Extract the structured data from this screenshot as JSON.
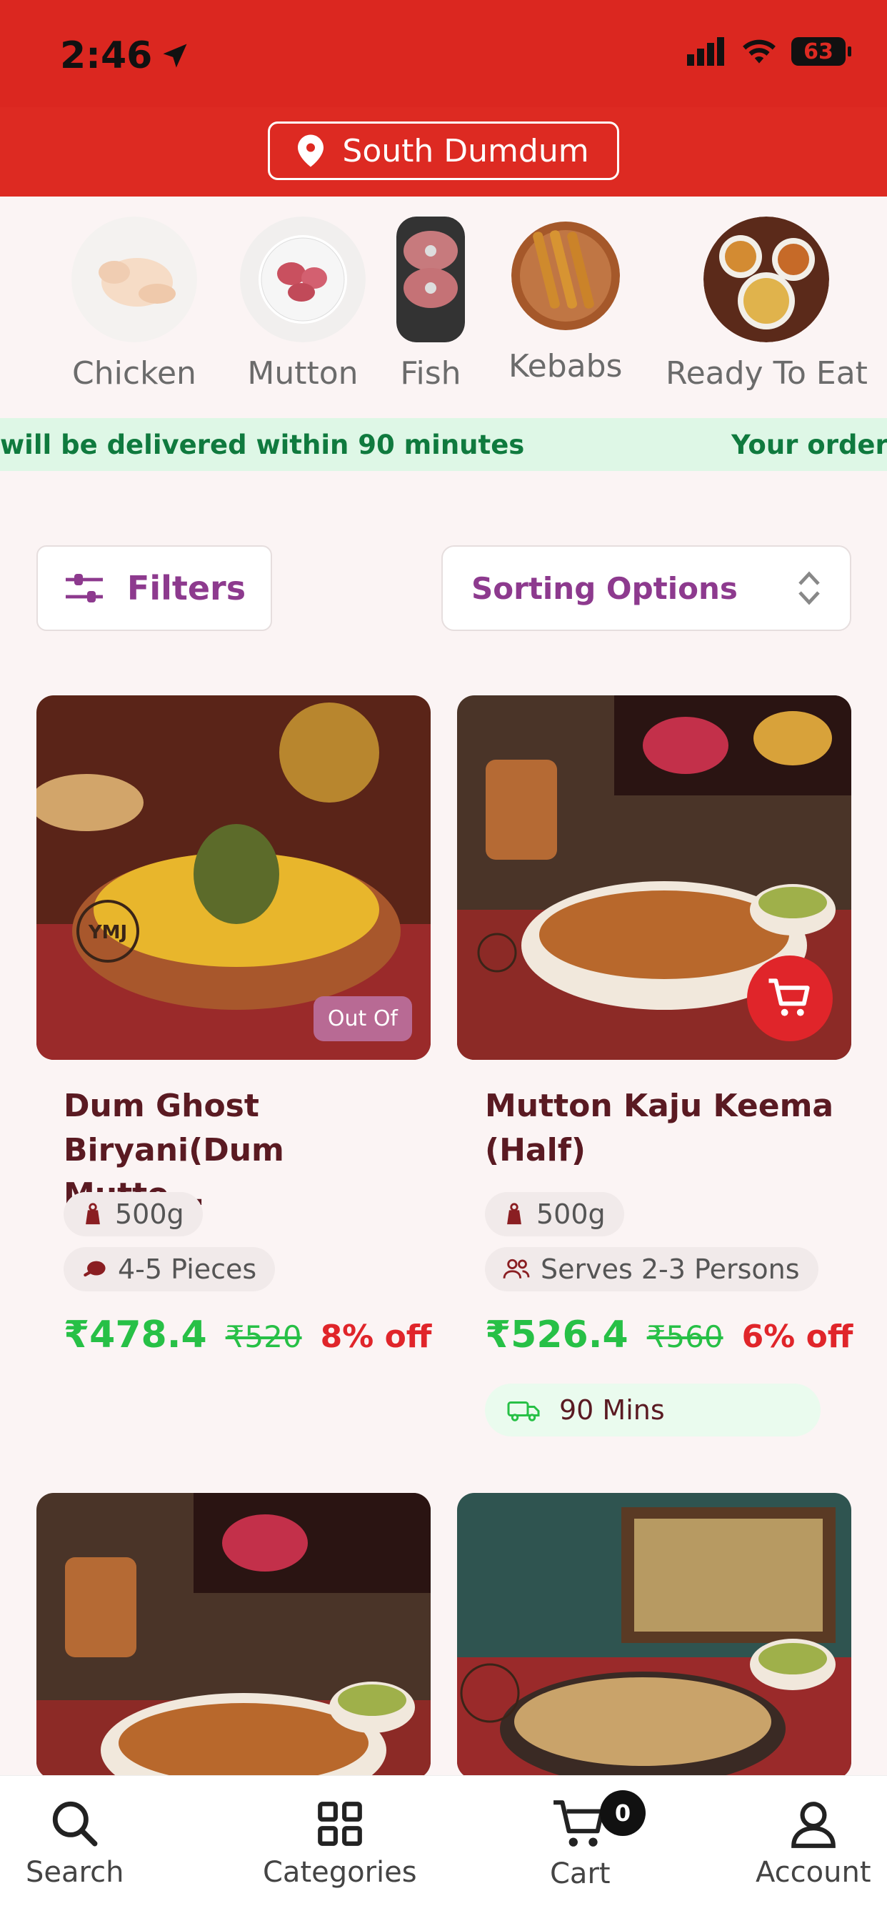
{
  "status_bar": {
    "time": "2:46",
    "battery": "63"
  },
  "header": {
    "location": "South Dumdum"
  },
  "categories": [
    {
      "label": "Chicken"
    },
    {
      "label": "Mutton"
    },
    {
      "label": "Fish"
    },
    {
      "label": "Kebabs"
    },
    {
      "label": "Ready To Eat"
    }
  ],
  "banner": {
    "text_left": "will be delivered within 90 minutes",
    "text_right": "Your order w"
  },
  "controls": {
    "filters_label": "Filters",
    "sort_label": "Sorting Options"
  },
  "products": [
    {
      "name": "Dum Ghost Biryani(Dum Mutto...",
      "weight": "500g",
      "detail": "4-5 Pieces",
      "price": "₹478.4",
      "mrp": "₹520",
      "discount": "8% off",
      "badge": "Out Of"
    },
    {
      "name": "Mutton Kaju Keema (Half)",
      "weight": "500g",
      "detail": "Serves 2-3 Persons",
      "price": "₹526.4",
      "mrp": "₹560",
      "discount": "6% off",
      "delivery": "90 Mins"
    }
  ],
  "bottom_nav": {
    "search": "Search",
    "categories": "Categories",
    "cart": "Cart",
    "cart_count": "0",
    "account": "Account"
  },
  "colors": {
    "brand_red": "#dd2a22",
    "accent_purple": "#8d3a8e",
    "price_green": "#27c046",
    "discount_red": "#e0252a"
  }
}
